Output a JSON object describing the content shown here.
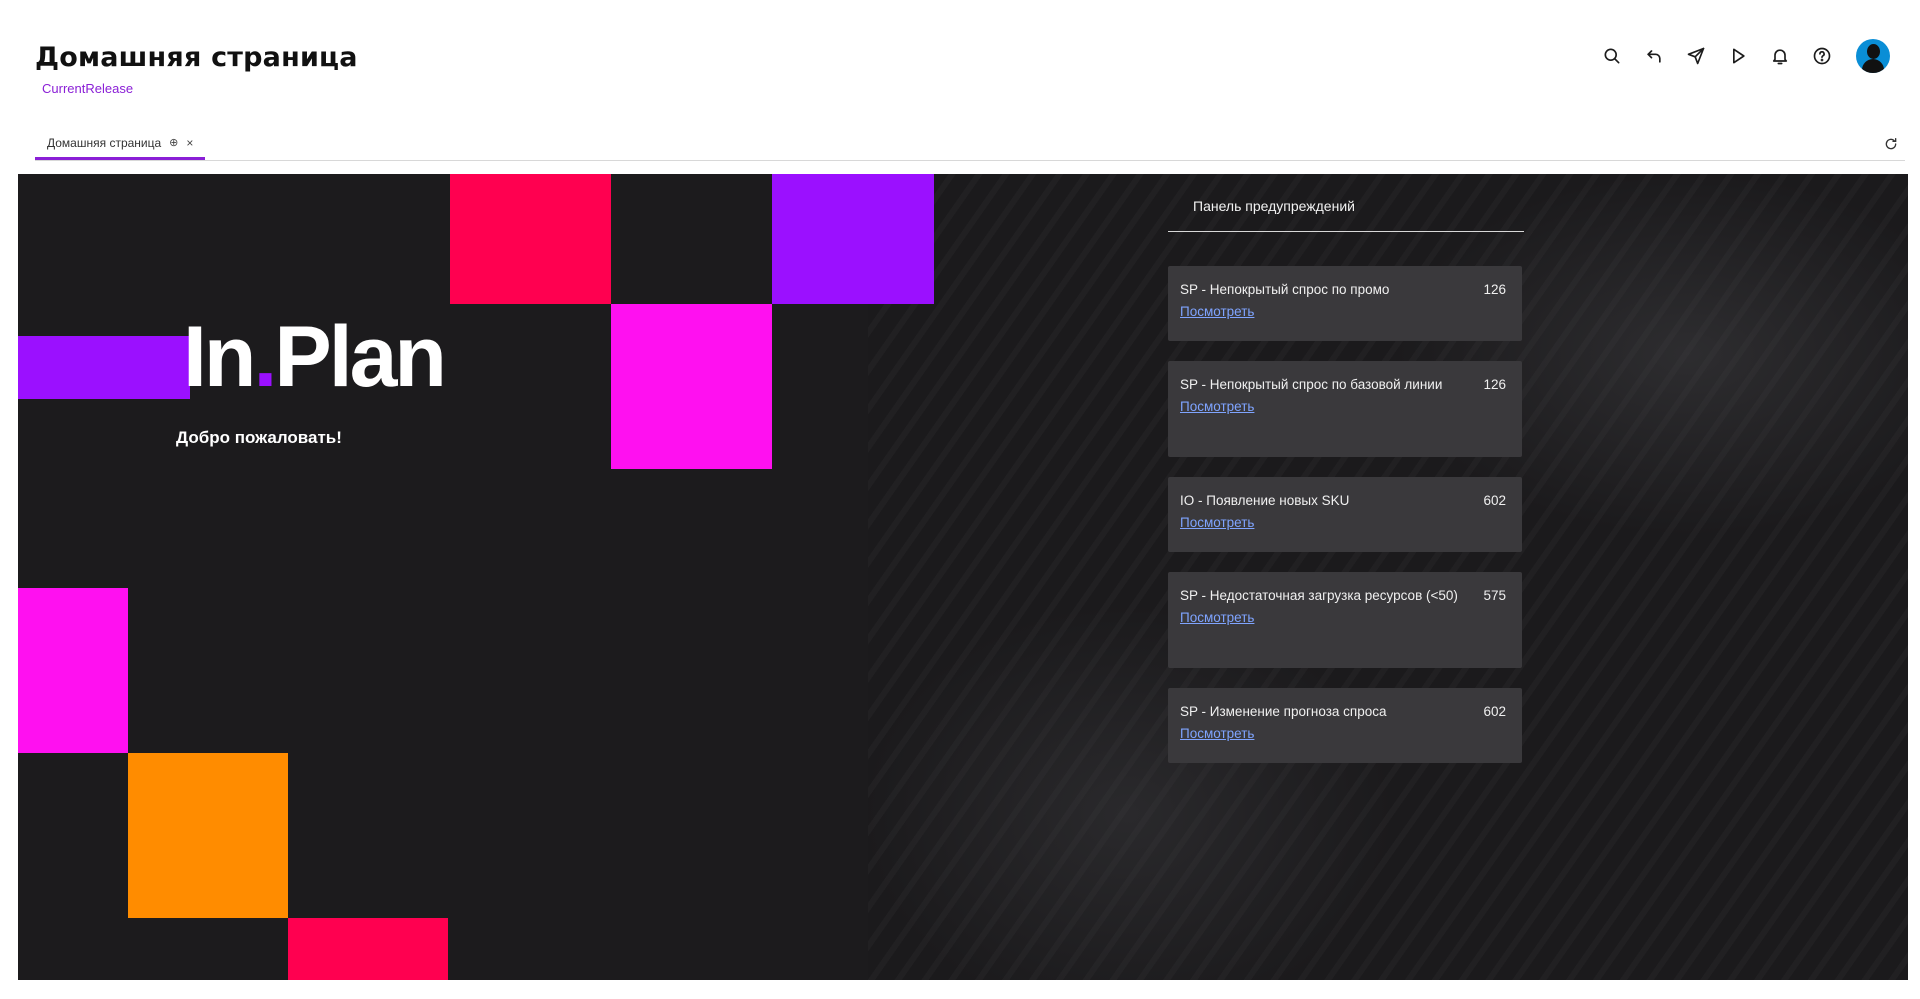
{
  "header": {
    "title": "Домашняя страница",
    "release": "CurrentRelease"
  },
  "toolbar": {
    "icons": [
      "search-icon",
      "undo-icon",
      "send-icon",
      "play-icon",
      "bell-icon",
      "help-icon",
      "avatar"
    ]
  },
  "tabs": [
    {
      "label": "Домашняя страница",
      "pin": "⊕",
      "close": "×"
    }
  ],
  "banner": {
    "logo_main": "In",
    "logo_dot": ".",
    "logo_rest": "Plan",
    "welcome": "Добро пожаловать!",
    "colors": {
      "red": "#ff0050",
      "purple": "#9b10ff",
      "magenta": "#ff10f0",
      "orange": "#ff8c00",
      "background": "#1c1b1d"
    }
  },
  "warnings": {
    "title": "Панель предупреждений",
    "link_label": "Посмотреть",
    "items": [
      {
        "title": "SP - Непокрытый спрос по промо",
        "count": "126"
      },
      {
        "title": "SP - Непокрытый спрос по базовой линии",
        "count": "126"
      },
      {
        "title": "IO - Появление новых SKU",
        "count": "602"
      },
      {
        "title": "SP - Недостаточная загрузка ресурсов (<50)",
        "count": "575"
      },
      {
        "title": "SP - Изменение прогноза спроса",
        "count": "602"
      }
    ]
  }
}
